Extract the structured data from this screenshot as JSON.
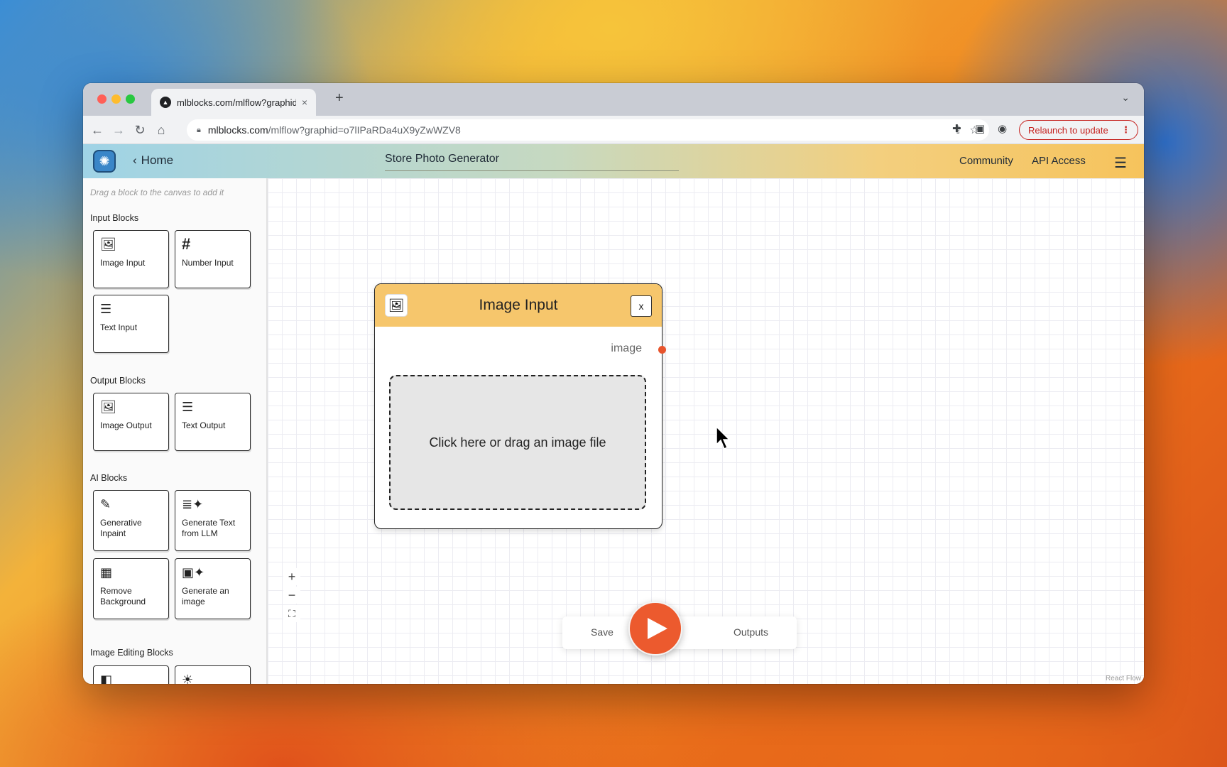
{
  "browser": {
    "tab_title": "mlblocks.com/mlflow?graphid",
    "tab_close": "×",
    "new_tab": "+",
    "tab_menu": "⌄",
    "url_host": "mlblocks.com",
    "url_path": "/mlflow?graphid=o7lIPaRDa4uX9yZwWZV8",
    "relaunch_label": "Relaunch to update",
    "nav_icons": [
      "back-icon",
      "forward-icon",
      "reload-icon",
      "home-icon"
    ],
    "toolbar_icons": [
      "share-icon",
      "star-icon",
      "extensions-icon",
      "sidepanel-icon",
      "profile-icon"
    ]
  },
  "app": {
    "home_label": "Home",
    "doc_title": "Store Photo Generator",
    "nav": {
      "community": "Community",
      "api_access": "API Access"
    }
  },
  "sidebar": {
    "hint": "Drag a block to the canvas to add it",
    "sections": [
      {
        "title": "Input Blocks",
        "blocks": [
          {
            "label": "Image Input",
            "icon": "image-icon"
          },
          {
            "label": "Number Input",
            "icon": "hash-icon"
          },
          {
            "label": "Text Input",
            "icon": "text-icon"
          }
        ]
      },
      {
        "title": "Output Blocks",
        "blocks": [
          {
            "label": "Image Output",
            "icon": "image-icon"
          },
          {
            "label": "Text Output",
            "icon": "text-icon"
          }
        ]
      },
      {
        "title": "AI Blocks",
        "blocks": [
          {
            "label": "Generative Inpaint",
            "icon": "brush-icon"
          },
          {
            "label": "Generate Text from LLM",
            "icon": "sparkle-text-icon"
          },
          {
            "label": "Remove Background",
            "icon": "remove-bg-icon"
          },
          {
            "label": "Generate an image",
            "icon": "sparkle-image-icon"
          }
        ]
      },
      {
        "title": "Image Editing Blocks",
        "blocks": []
      }
    ]
  },
  "node": {
    "title": "Image Input",
    "close_label": "x",
    "output_label": "image",
    "dropzone_text": "Click here or drag an image file"
  },
  "controls": {
    "zoom_in": "+",
    "zoom_out": "−",
    "fit": "⛶"
  },
  "runbar": {
    "save_label": "Save",
    "outputs_label": "Outputs"
  },
  "attribution": "React Flow",
  "colors": {
    "header_gradient_start": "#9fd3e6",
    "header_gradient_end": "#f6c35c",
    "node_header": "#f6c66c",
    "accent": "#ec5a2e",
    "relaunch": "#c5221f"
  }
}
